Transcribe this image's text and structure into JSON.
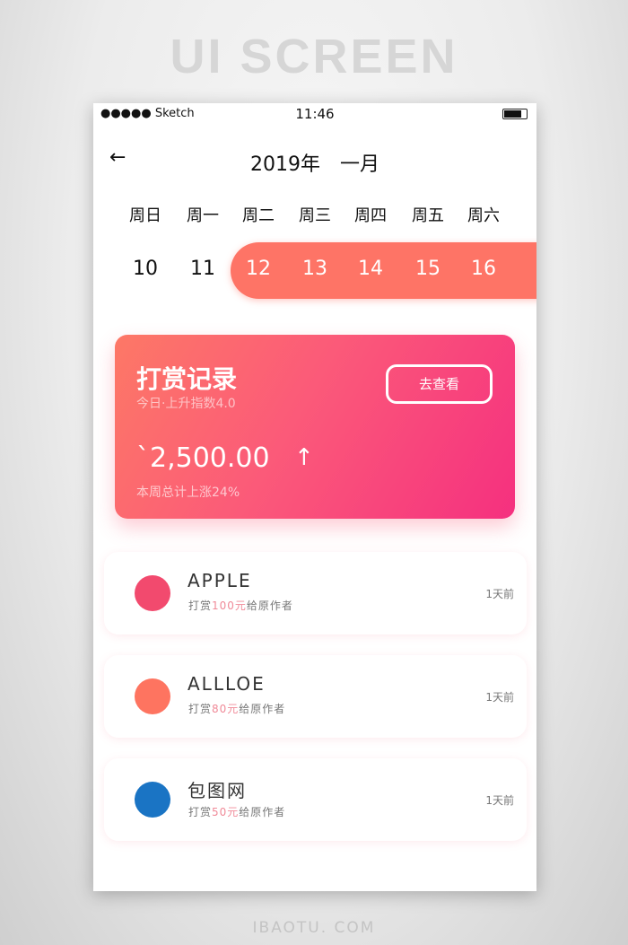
{
  "banner": "UI SCREEN",
  "footer": "IBAOTU. COM",
  "status": {
    "carrier": "●●●●● Sketch",
    "wifi": "wifi-icon",
    "time": "11:46",
    "battery": "battery-icon"
  },
  "header": {
    "back": "←",
    "title": "2019年　一月"
  },
  "weekdays": [
    "周日",
    "周一",
    "周二",
    "周三",
    "周四",
    "周五",
    "周六"
  ],
  "days": [
    "10",
    "11",
    "12",
    "13",
    "14",
    "15",
    "16"
  ],
  "selected_range": [
    "12",
    "16"
  ],
  "card": {
    "title": "打赏记录",
    "subtitle": "今日·上升指数4.0",
    "button": "去查看",
    "amount": "`2,500.00",
    "arrow": "↑",
    "note": "本周总计上涨24%",
    "gradient": [
      "#fd7866",
      "#f5307f"
    ]
  },
  "records": [
    {
      "name": "APPLE",
      "pre": "打赏",
      "amount": "100元",
      "post": "给原作者",
      "time": "1天前",
      "color": "#f24a6e"
    },
    {
      "name": "ALLLOE",
      "pre": "打赏",
      "amount": "80元",
      "post": "给原作者",
      "time": "1天前",
      "color": "#fe7460"
    },
    {
      "name": "包图网",
      "pre": "打赏",
      "amount": "50元",
      "post": "给原作者",
      "time": "1天前",
      "color": "#1a74c4"
    }
  ]
}
